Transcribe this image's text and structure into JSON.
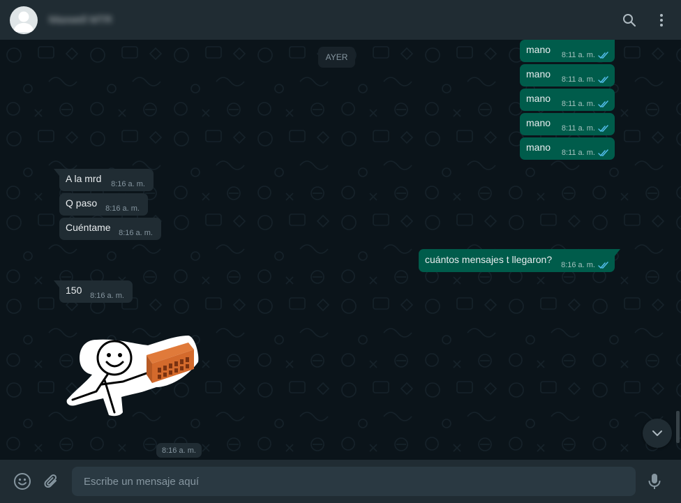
{
  "header": {
    "contact_name": "Maxwell MTR",
    "avatar_icon": "default-user-avatar-icon",
    "search_icon": "search-icon",
    "menu_icon": "kebab-menu-icon"
  },
  "chat": {
    "day_separator": "AYER",
    "messages": [
      {
        "direction": "out",
        "text": "mano",
        "time": "8:11 a. m.",
        "status": "read"
      },
      {
        "direction": "out",
        "text": "mano",
        "time": "8:11 a. m.",
        "status": "read"
      },
      {
        "direction": "out",
        "text": "mano",
        "time": "8:11 a. m.",
        "status": "read"
      },
      {
        "direction": "out",
        "text": "mano",
        "time": "8:11 a. m.",
        "status": "read"
      },
      {
        "direction": "out",
        "text": "mano",
        "time": "8:11 a. m.",
        "status": "read"
      },
      {
        "direction": "in",
        "text": "A la mrd",
        "time": "8:16 a. m."
      },
      {
        "direction": "in",
        "text": "Q paso",
        "time": "8:16 a. m."
      },
      {
        "direction": "in",
        "text": "Cuéntame",
        "time": "8:16 a. m."
      },
      {
        "direction": "out",
        "text": "cuántos mensajes t llegaron?",
        "time": "8:16 a. m.",
        "status": "read"
      },
      {
        "direction": "in",
        "text": "150",
        "time": "8:16 a. m."
      }
    ],
    "sticker": {
      "icon": "meme-guy-with-brick-sticker",
      "time": "8:16 a. m."
    },
    "scroll_down_icon": "chevron-down-icon"
  },
  "composer": {
    "emoji_icon": "emoji-icon",
    "attach_icon": "paperclip-icon",
    "placeholder": "Escribe un mensaje aquí",
    "value": "",
    "mic_icon": "microphone-icon"
  },
  "colors": {
    "background": "#0b141a",
    "header": "#202c33",
    "outgoing_bubble": "#005c4b",
    "incoming_bubble": "#202c33",
    "read_ticks": "#53bdeb",
    "secondary_text": "#8696a0"
  }
}
